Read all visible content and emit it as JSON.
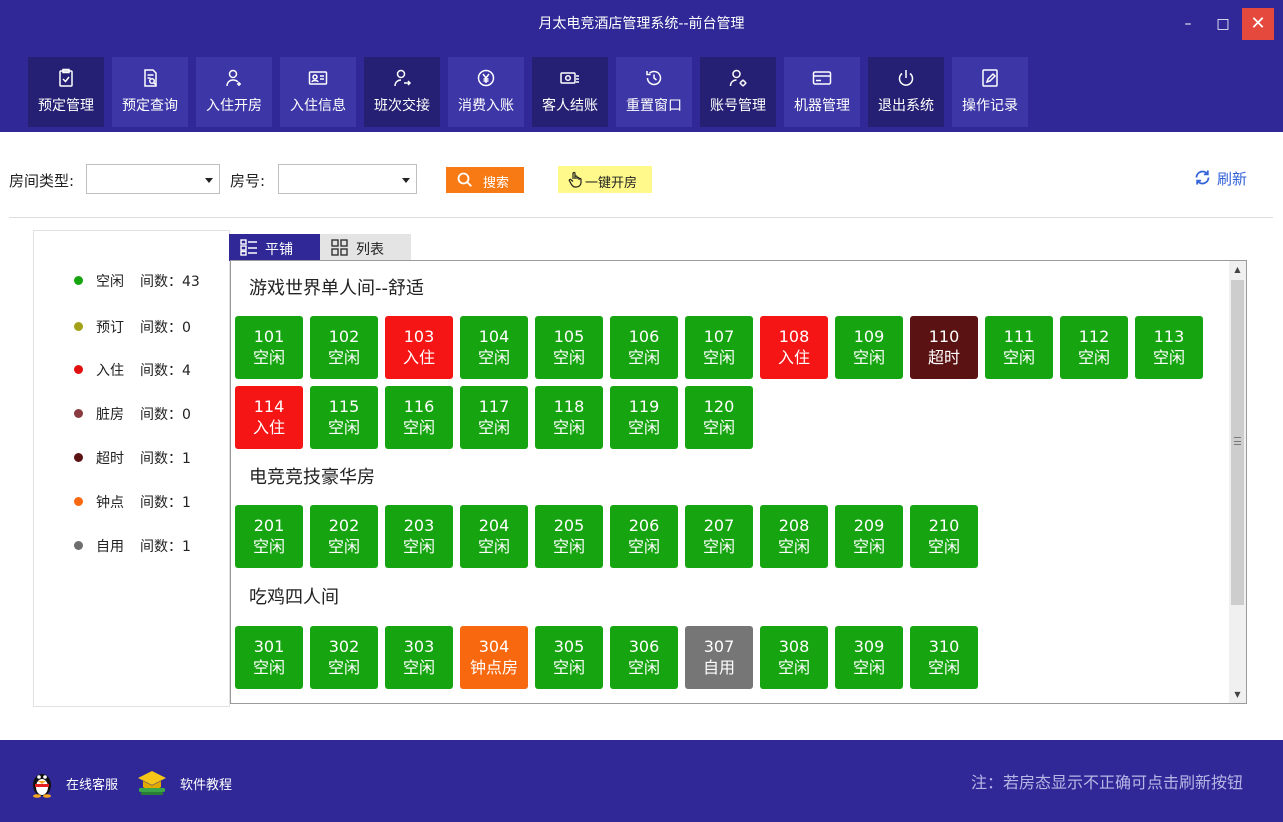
{
  "window": {
    "title": "月太电竞酒店管理系统--前台管理",
    "minimize_glyph": "–",
    "maximize_glyph": "□",
    "close_glyph": "✕"
  },
  "toolbar": [
    {
      "label": "预定管理",
      "icon": "clipboard-check-icon"
    },
    {
      "label": "预定查询",
      "icon": "document-search-icon"
    },
    {
      "label": "入住开房",
      "icon": "user-add-icon"
    },
    {
      "label": "入住信息",
      "icon": "id-card-icon"
    },
    {
      "label": "班次交接",
      "icon": "user-switch-icon"
    },
    {
      "label": "消费入账",
      "icon": "yen-coin-icon"
    },
    {
      "label": "客人结账",
      "icon": "cash-register-icon"
    },
    {
      "label": "重置窗口",
      "icon": "history-icon"
    },
    {
      "label": "账号管理",
      "icon": "user-settings-icon"
    },
    {
      "label": "机器管理",
      "icon": "card-icon"
    },
    {
      "label": "退出系统",
      "icon": "power-icon"
    },
    {
      "label": "操作记录",
      "icon": "edit-note-icon"
    }
  ],
  "filters": {
    "room_type_label": "房间类型:",
    "room_type_value": "",
    "room_no_label": "房号:",
    "room_no_value": "",
    "search_label": "搜索",
    "one_click_label": "一键开房",
    "refresh_label": "刷新"
  },
  "legend": [
    {
      "name": "空闲",
      "count": "间数：43",
      "color": "#16a510"
    },
    {
      "name": "预订",
      "count": "间数：0",
      "color": "#a3a019"
    },
    {
      "name": "入住",
      "count": "间数：4",
      "color": "#e01010"
    },
    {
      "name": "脏房",
      "count": "间数：0",
      "color": "#8a3b3f"
    },
    {
      "name": "超时",
      "count": "间数：1",
      "color": "#5a1212"
    },
    {
      "name": "钟点",
      "count": "间数：1",
      "color": "#f7680f"
    },
    {
      "name": "自用",
      "count": "间数：1",
      "color": "#6e6e6e"
    }
  ],
  "view_tabs": {
    "tile_label": "平铺",
    "list_label": "列表"
  },
  "status_colors": {
    "空闲": "#16a510",
    "入住": "#f51515",
    "超时": "#5a1212",
    "钟点房": "#f7680f",
    "自用": "#767676"
  },
  "groups": [
    {
      "title": "游戏世界单人间--舒适",
      "rooms": [
        {
          "no": "101",
          "status": "空闲"
        },
        {
          "no": "102",
          "status": "空闲"
        },
        {
          "no": "103",
          "status": "入住"
        },
        {
          "no": "104",
          "status": "空闲"
        },
        {
          "no": "105",
          "status": "空闲"
        },
        {
          "no": "106",
          "status": "空闲"
        },
        {
          "no": "107",
          "status": "空闲"
        },
        {
          "no": "108",
          "status": "入住"
        },
        {
          "no": "109",
          "status": "空闲"
        },
        {
          "no": "110",
          "status": "超时"
        },
        {
          "no": "111",
          "status": "空闲"
        },
        {
          "no": "112",
          "status": "空闲"
        },
        {
          "no": "113",
          "status": "空闲"
        },
        {
          "no": "114",
          "status": "入住"
        },
        {
          "no": "115",
          "status": "空闲"
        },
        {
          "no": "116",
          "status": "空闲"
        },
        {
          "no": "117",
          "status": "空闲"
        },
        {
          "no": "118",
          "status": "空闲"
        },
        {
          "no": "119",
          "status": "空闲"
        },
        {
          "no": "120",
          "status": "空闲"
        }
      ]
    },
    {
      "title": "电竞竞技豪华房",
      "rooms": [
        {
          "no": "201",
          "status": "空闲"
        },
        {
          "no": "202",
          "status": "空闲"
        },
        {
          "no": "203",
          "status": "空闲"
        },
        {
          "no": "204",
          "status": "空闲"
        },
        {
          "no": "205",
          "status": "空闲"
        },
        {
          "no": "206",
          "status": "空闲"
        },
        {
          "no": "207",
          "status": "空闲"
        },
        {
          "no": "208",
          "status": "空闲"
        },
        {
          "no": "209",
          "status": "空闲"
        },
        {
          "no": "210",
          "status": "空闲"
        }
      ]
    },
    {
      "title": "吃鸡四人间",
      "rooms": [
        {
          "no": "301",
          "status": "空闲"
        },
        {
          "no": "302",
          "status": "空闲"
        },
        {
          "no": "303",
          "status": "空闲"
        },
        {
          "no": "304",
          "status": "钟点房"
        },
        {
          "no": "305",
          "status": "空闲"
        },
        {
          "no": "306",
          "status": "空闲"
        },
        {
          "no": "307",
          "status": "自用"
        },
        {
          "no": "308",
          "status": "空闲"
        },
        {
          "no": "309",
          "status": "空闲"
        },
        {
          "no": "310",
          "status": "空闲"
        }
      ]
    }
  ],
  "footer": {
    "service_label": "在线客服",
    "tutorial_label": "软件教程",
    "note": "注：若房态显示不正确可点击刷新按钮"
  }
}
